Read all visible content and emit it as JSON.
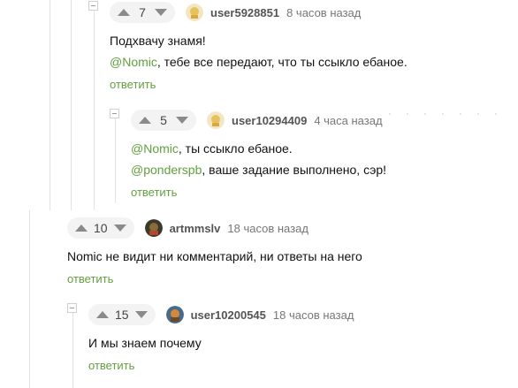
{
  "comments": [
    {
      "votes": "7",
      "username": "user5928851",
      "time": "8 часов назад",
      "lines": [
        {
          "mention": "",
          "text": "Подхвачу знамя!"
        },
        {
          "mention": "@Nomic",
          "text": ", тебе все передают, что ты ссыкло ебаное."
        }
      ],
      "reply": "ответить"
    },
    {
      "votes": "5",
      "username": "user10294409",
      "time": "4 часа назад",
      "lines": [
        {
          "mention": "@Nomic",
          "text": ", ты ссыкло ебаное."
        },
        {
          "mention": "@ponderspb",
          "text": ", ваше задание выполнено, сэр!"
        }
      ],
      "reply": "ответить"
    },
    {
      "votes": "10",
      "username": "artmmslv",
      "time": "18 часов назад",
      "lines": [
        {
          "mention": "",
          "text": "Nomic не видит ни комментарий, ни ответы на него"
        }
      ],
      "reply": "ответить"
    },
    {
      "votes": "15",
      "username": "user10200545",
      "time": "18 часов назад",
      "lines": [
        {
          "mention": "",
          "text": "И мы знаем почему"
        }
      ],
      "reply": "ответить"
    }
  ],
  "colors": {
    "accent": "#62a03f",
    "voter_bg": "#f3f3f3",
    "guide_line": "#e2e2e2"
  }
}
